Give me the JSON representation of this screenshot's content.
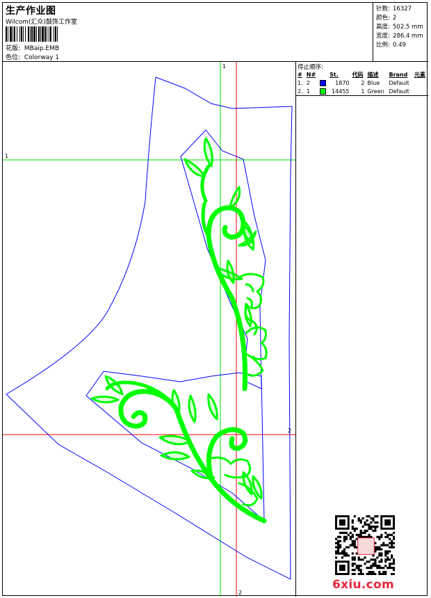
{
  "header": {
    "title": "生产作业图",
    "company": "Wilcom(汇众)鼓饰工作室",
    "design_label": "花版:",
    "design_value": "MBaip.EMB",
    "colorway_label": "色位:",
    "colorway_value": "Colorway 1"
  },
  "stats": [
    {
      "label": "针数:",
      "value": "16327"
    },
    {
      "label": "颜色:",
      "value": "2"
    },
    {
      "label": "高度:",
      "value": "502.5 mm"
    },
    {
      "label": "宽度:",
      "value": "286.4 mm"
    },
    {
      "label": "比例:",
      "value": "0.49"
    }
  ],
  "stop_sequence": {
    "title": "停止顺序:",
    "columns": [
      "#",
      "N#",
      "",
      "St.",
      "代码",
      "描述",
      "Brand",
      "元素"
    ],
    "rows": [
      {
        "index": "1.",
        "needle": "2",
        "color": "#0000ff",
        "stitches": "1870",
        "code": "2",
        "description": "Blue",
        "brand": "Default",
        "element": ""
      },
      {
        "index": "2.",
        "needle": "1",
        "color": "#00ff00",
        "stitches": "14455",
        "code": "1",
        "description": "Green",
        "brand": "Default",
        "element": ""
      }
    ]
  },
  "guides": {
    "green_top_label": "1",
    "green_left_label": "1",
    "red_right_label": "2",
    "red_bottom_label": "2"
  },
  "colors": {
    "outline": "#0000ff",
    "embroidery": "#00ff00",
    "guide_green": "#00dd00",
    "guide_red": "#ff0000",
    "watermark": "#e8283c"
  },
  "watermark": {
    "text": "6xiu.com",
    "qr_icon": "qr-code-icon",
    "stamp_icon": "seal-stamp-icon"
  }
}
